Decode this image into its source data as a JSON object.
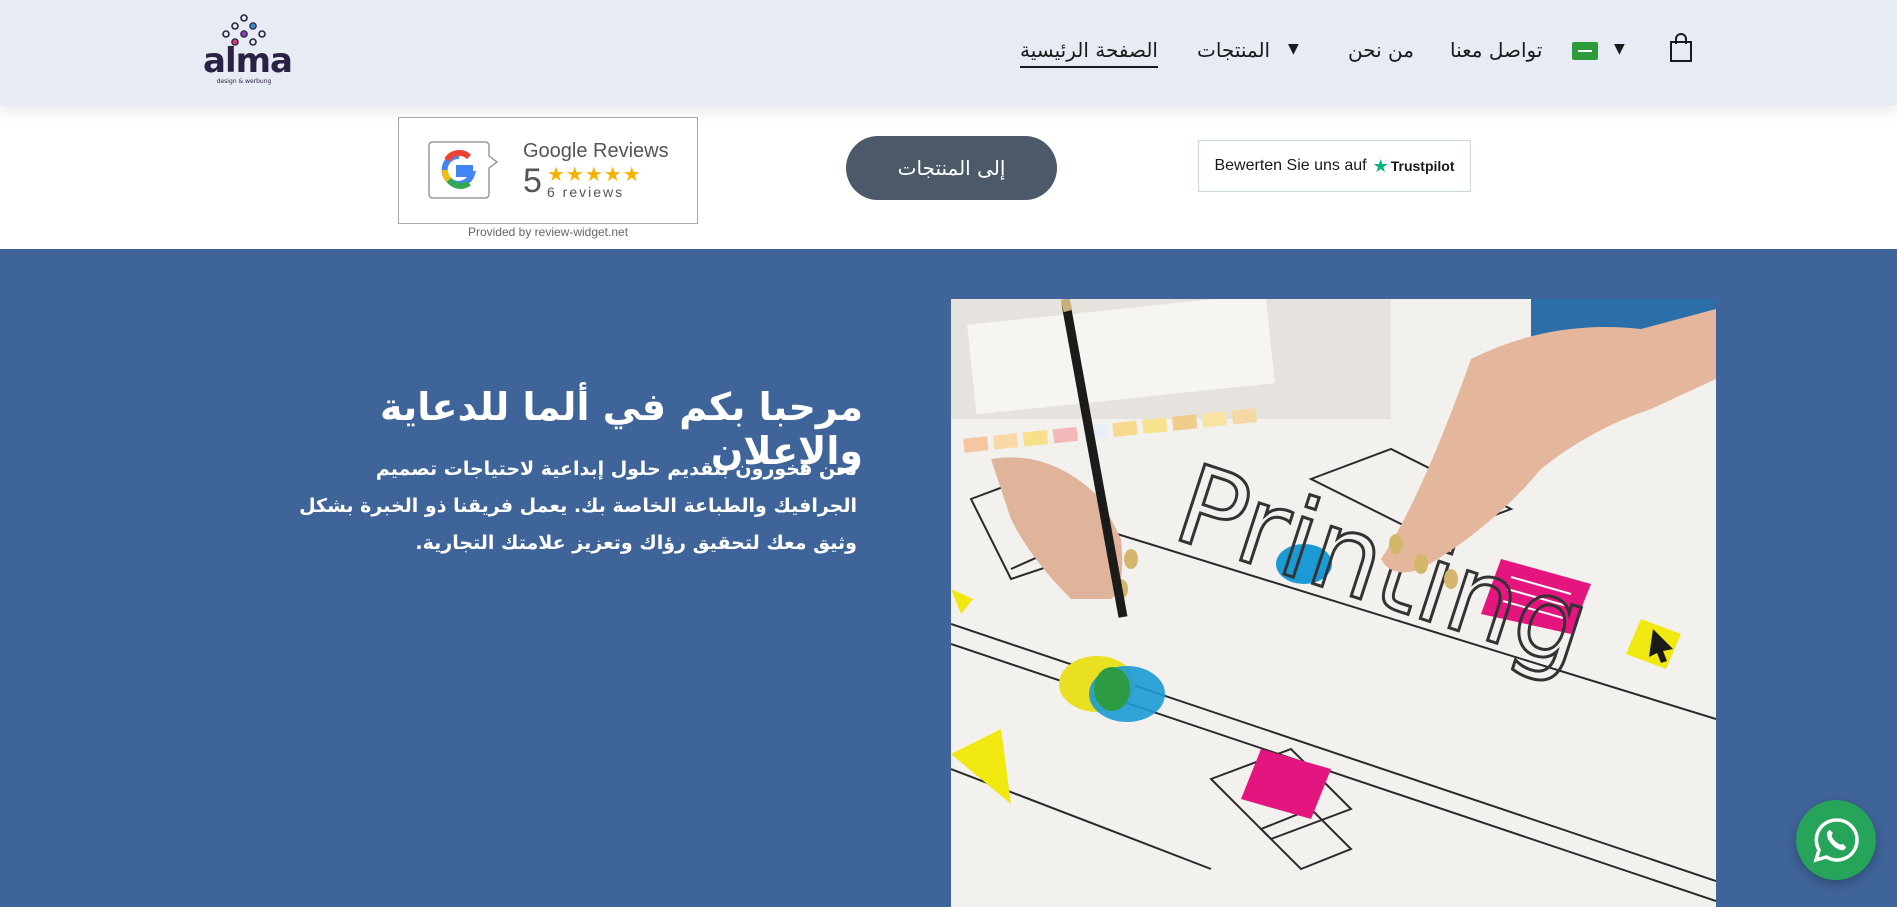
{
  "brand": {
    "logo_text": "alma",
    "logo_sub": "design & werbung"
  },
  "nav": {
    "home": "الصفحة الرئيسية",
    "products": "المنتجات",
    "about": "من نحن",
    "contact": "تواصل معنا",
    "dropdown_caret": "▼",
    "language_flag": "saudi-flag-icon",
    "cart": "shopping-bag-icon"
  },
  "reviews": {
    "google_title": "Google Reviews",
    "google_score": "5",
    "google_stars": "★★★★★",
    "google_count": "6 reviews",
    "provided_by": "Provided by review-widget.net",
    "trustpilot_text": "Bewerten Sie uns auf",
    "trustpilot_brand": "Trustpilot"
  },
  "cta": {
    "label": "إلى المنتجات"
  },
  "hero": {
    "title": "مرحبا بكم في ألما للدعاية والإعلان",
    "body": "نحن فخورون بتقديم حلول إبداعية لاحتياجات تصميم الجرافيك والطباعة الخاصة بك. يعمل فريقنا ذو الخبرة بشكل وثيق معك لتحقيق رؤاك وتعزيز علامتك التجارية.",
    "image_word": "Printing"
  },
  "colors": {
    "header_bg": "#e7ebf3",
    "hero_bg": "#3f6499",
    "cta_bg": "#4b5968",
    "whatsapp": "#25a45a",
    "star": "#f5b301",
    "trustpilot_green": "#00b67a"
  }
}
